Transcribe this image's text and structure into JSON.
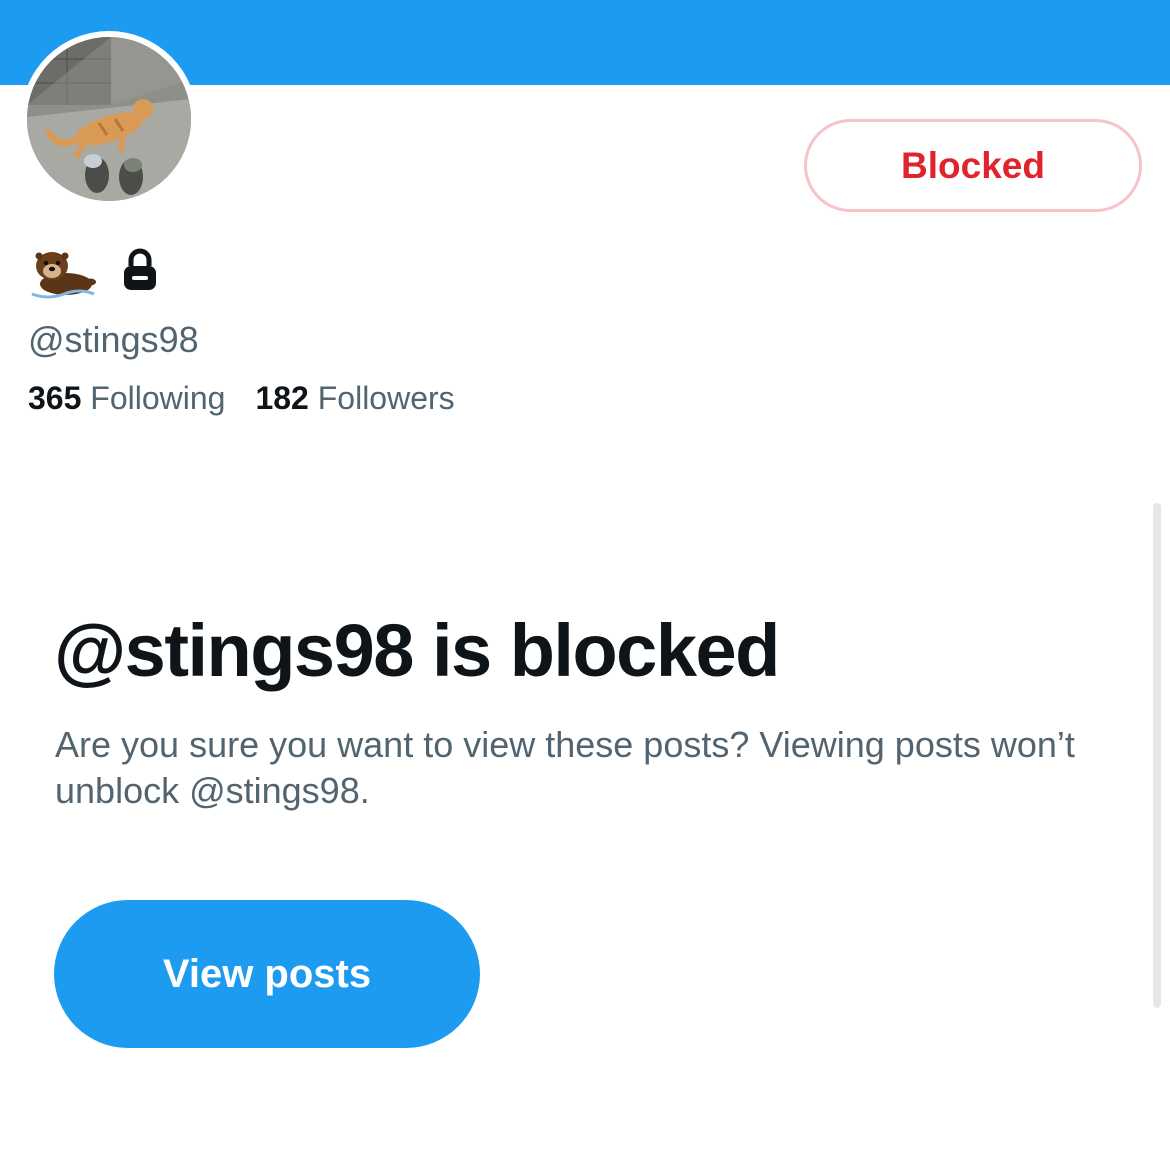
{
  "profile": {
    "display_name_icons": [
      "otter-emoji",
      "lock-icon"
    ],
    "handle": "@stings98",
    "following_count": "365",
    "following_label": "Following",
    "followers_count": "182",
    "followers_label": "Followers",
    "blocked_button_label": "Blocked"
  },
  "blocked_notice": {
    "title": "@stings98 is blocked",
    "description": "Are you sure you want to view these posts? Viewing posts won’t unblock @stings98.",
    "button_label": "View posts"
  },
  "colors": {
    "banner": "#1d9bf0",
    "accent": "#1d9bf0",
    "blocked_red": "#e0242f",
    "secondary_text": "#536471",
    "primary_text": "#0f1419"
  }
}
